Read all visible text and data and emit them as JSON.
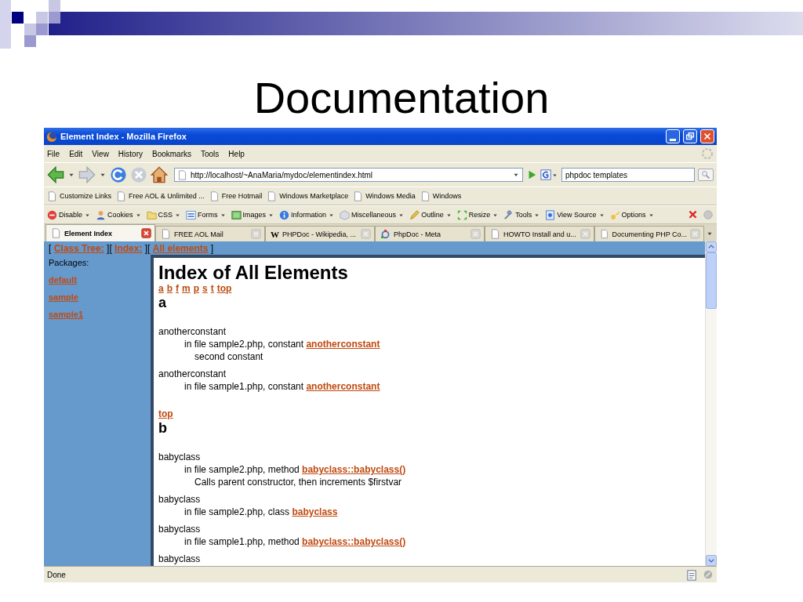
{
  "slide": {
    "title": "Documentation"
  },
  "browser": {
    "title": "Element Index - Mozilla Firefox",
    "menu": [
      "File",
      "Edit",
      "View",
      "History",
      "Bookmarks",
      "Tools",
      "Help"
    ],
    "address": "http://localhost/~AnaMaria/mydoc/elementindex.html",
    "search": "phpdoc templates",
    "bookmarks": [
      "Customize Links",
      "Free AOL & Unlimited ...",
      "Free Hotmail",
      "Windows Marketplace",
      "Windows Media",
      "Windows"
    ],
    "devtools": [
      "Disable",
      "Cookies",
      "CSS",
      "Forms",
      "Images",
      "Information",
      "Miscellaneous",
      "Outline",
      "Resize",
      "Tools",
      "View Source",
      "Options"
    ],
    "tabs": [
      {
        "label": "Element Index",
        "selected": true,
        "kind": "page"
      },
      {
        "label": "FREE AOL Mail",
        "selected": false,
        "kind": "page"
      },
      {
        "label": "PHPDoc - Wikipedia, ...",
        "selected": false,
        "kind": "letter",
        "icon_text": "W"
      },
      {
        "label": "PhpDoc - Meta",
        "selected": false,
        "kind": "rings"
      },
      {
        "label": "HOWTO Install and u...",
        "selected": false,
        "kind": "page"
      },
      {
        "label": "Documenting PHP Co...",
        "selected": false,
        "kind": "page"
      }
    ],
    "status": "Done"
  },
  "page": {
    "nav": [
      {
        "kind": "text",
        "text": "[ "
      },
      {
        "kind": "link",
        "text": "Class Tree:"
      },
      {
        "kind": "text",
        "text": " ][ "
      },
      {
        "kind": "link",
        "text": "Index:"
      },
      {
        "kind": "text",
        "text": " ][ "
      },
      {
        "kind": "link",
        "text": "All elements"
      },
      {
        "kind": "text",
        "text": " ]"
      }
    ],
    "packages_label": "Packages:",
    "packages": [
      "default",
      "sample",
      "sample1"
    ],
    "heading": "Index of All Elements",
    "letters": [
      "a",
      "b",
      "f",
      "m",
      "p",
      "s",
      "t",
      "top"
    ],
    "sections": [
      {
        "letter": "a",
        "top": "top",
        "entries": [
          {
            "name": "anotherconstant",
            "location": "in file sample2.php, constant",
            "link": "anotherconstant",
            "description": "second constant"
          },
          {
            "name": "anotherconstant",
            "location": "in file sample1.php, constant",
            "link": "anotherconstant"
          }
        ]
      },
      {
        "letter": "b",
        "entries": [
          {
            "name": "babyclass",
            "location": "in file sample2.php, method",
            "link": "babyclass::babyclass()",
            "description": "Calls parent constructor, then increments $firstvar"
          },
          {
            "name": "babyclass",
            "location": "in file sample2.php, class",
            "link": "babyclass"
          },
          {
            "name": "babyclass",
            "location": "in file sample1.php, method",
            "link": "babyclass::babyclass()"
          },
          {
            "name": "babyclass"
          }
        ]
      }
    ]
  }
}
